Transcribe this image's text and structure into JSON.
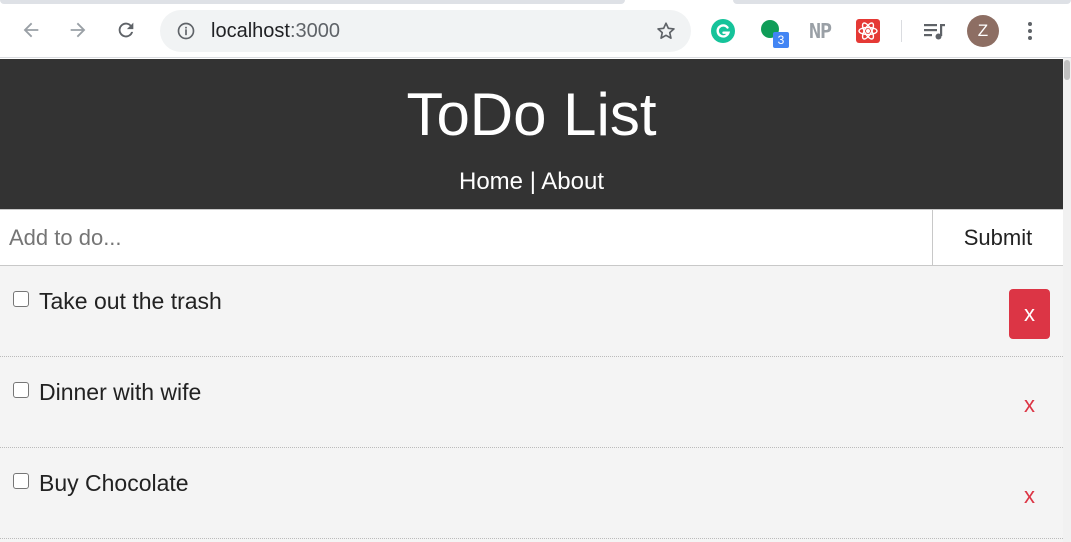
{
  "browser": {
    "url_host": "localhost",
    "url_port": ":3000",
    "extensions": {
      "grammarly_icon": "grammarly-icon",
      "badge_count": "3",
      "np_label": "NP"
    },
    "avatar_initial": "Z"
  },
  "app": {
    "title": "ToDo List",
    "nav": {
      "home": "Home",
      "separator": " | ",
      "about": "About"
    },
    "form": {
      "placeholder": "Add to do...",
      "submit_label": "Submit"
    },
    "todos": [
      {
        "title": "Take out the trash",
        "completed": false,
        "delete_label": "x"
      },
      {
        "title": "Dinner with wife",
        "completed": false,
        "delete_label": "x"
      },
      {
        "title": "Buy Chocolate",
        "completed": false,
        "delete_label": "x"
      }
    ]
  },
  "colors": {
    "header_bg": "#333333",
    "page_bg": "#f4f4f4",
    "delete_red": "#dc3545",
    "grammarly_green": "#15c39a",
    "ext_green": "#0f9d58",
    "badge_blue": "#4285f4"
  }
}
